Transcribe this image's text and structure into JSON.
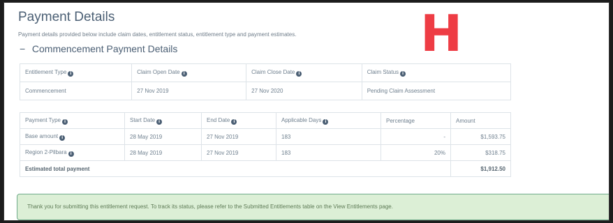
{
  "page": {
    "title": "Payment Details",
    "description": "Payment details provided below include claim dates, entitlement status, entitlement type and payment estimates.",
    "overlay_letter": "H"
  },
  "section": {
    "toggle": "−",
    "title": "Commencement Payment Details"
  },
  "claim_table": {
    "headers": [
      "Entitlement Type",
      "Claim Open Date",
      "Claim Close Date",
      "Claim Status"
    ],
    "row": [
      "Commencement",
      "27 Nov 2019",
      "27 Nov 2020",
      "Pending Claim Assessment"
    ]
  },
  "payment_table": {
    "headers": [
      "Payment Type",
      "Start Date",
      "End Date",
      "Applicable Days",
      "Percentage",
      "Amount"
    ],
    "rows": [
      [
        "Base amount",
        "28 May 2019",
        "27 Nov 2019",
        "183",
        "-",
        "$1,593.75"
      ],
      [
        "Region 2-Pilbara",
        "28 May 2019",
        "27 Nov 2019",
        "183",
        "20%",
        "$318.75"
      ]
    ],
    "total_label": "Estimated total payment",
    "total_amount": "$1,912.50"
  },
  "alert": {
    "message": "Thank you for submitting this entitlement request. To track its status, please refer to the Submitted Entitlements table on the View Entitlements page."
  },
  "icons": {
    "info_glyph": "i"
  },
  "colors": {
    "title": "#4b5f74",
    "accent_red": "#ee3c44",
    "alert_bg": "#dcefd6",
    "alert_border": "#6fab8a"
  }
}
